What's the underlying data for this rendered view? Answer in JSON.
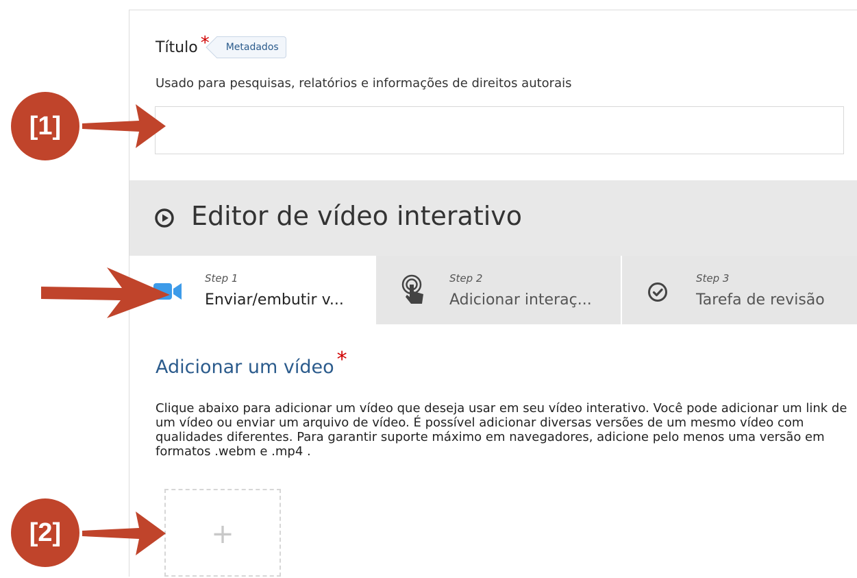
{
  "title_field": {
    "label": "Título",
    "required_mark": "*",
    "metadata_button": "Metadados",
    "description": "Usado para pesquisas, relatórios e informações de direitos autorais",
    "value": ""
  },
  "editor": {
    "title": "Editor de vídeo interativo",
    "icon": "play-circle-icon"
  },
  "steps": [
    {
      "number": "Step 1",
      "label": "Enviar/embutir v...",
      "icon": "video-camera-icon",
      "active": true
    },
    {
      "number": "Step 2",
      "label": "Adicionar interaç...",
      "icon": "touch-icon",
      "active": false
    },
    {
      "number": "Step 3",
      "label": "Tarefa de revisão",
      "icon": "check-circle-icon",
      "active": false
    }
  ],
  "add_video": {
    "title": "Adicionar um vídeo",
    "required_mark": "*",
    "description": "Clique abaixo para adicionar um vídeo que deseja usar em seu vídeo interativo. Você pode adicionar um link de um vídeo ou enviar um arquivo de vídeo. É possível adicionar diversas versões de um mesmo vídeo com qualidades diferentes. Para garantir suporte máximo em navegadores, adicione pelo menos uma versão em formatos .webm e .mp4 .",
    "add_button": "+"
  },
  "annotations": {
    "badge_1": "[1]",
    "badge_2": "[2]"
  },
  "colors": {
    "accent_blue": "#2b5b8c",
    "camera_blue": "#3d9be9",
    "required_red": "#d00000",
    "annotation_orange": "#c0442b"
  }
}
